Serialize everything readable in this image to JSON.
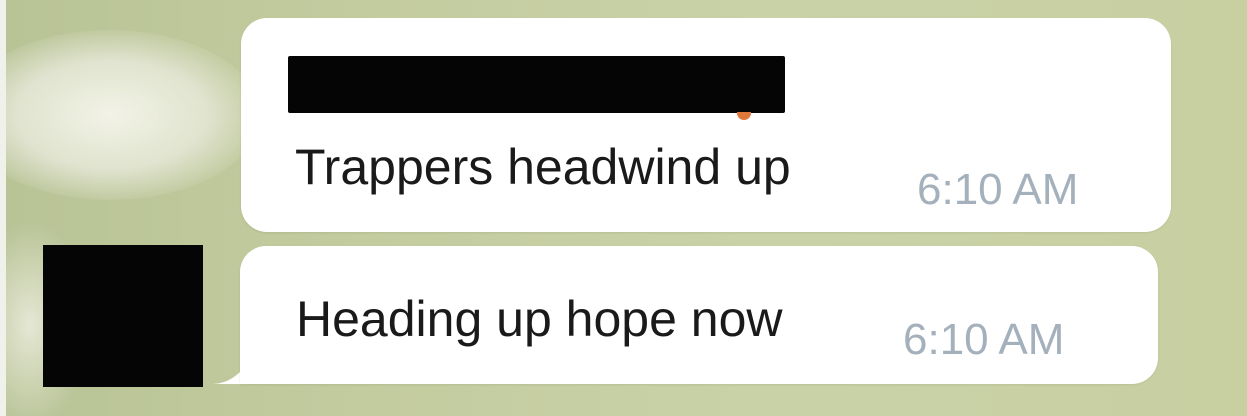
{
  "chat": {
    "messages": [
      {
        "sender": "",
        "text": "Trappers headwind up",
        "time": "6:10 AM"
      },
      {
        "text": "Heading up hope now",
        "time": "6:10 AM"
      }
    ]
  },
  "colors": {
    "bubble": "#ffffff",
    "text": "#1a1a1a",
    "timestamp": "#a4b1bc",
    "redaction": "#050505",
    "background": "#c3cc9f"
  },
  "icons": {
    "avatar": "redacted-avatar"
  }
}
